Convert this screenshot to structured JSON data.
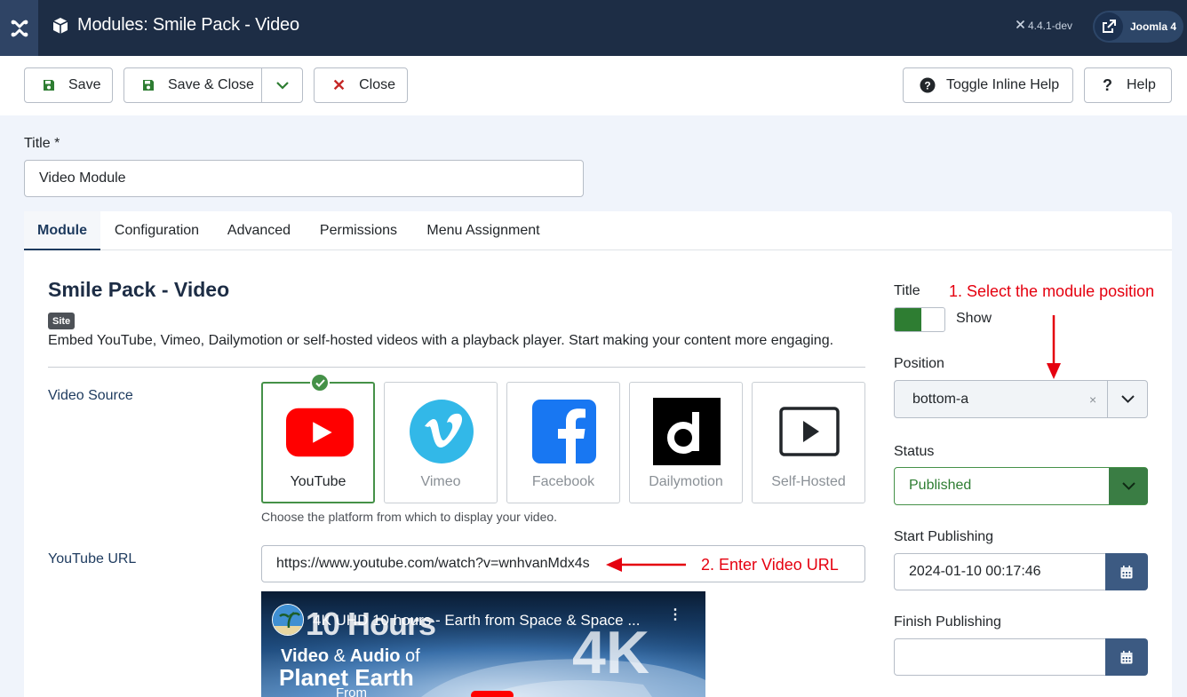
{
  "header": {
    "page_title": "Modules: Smile Pack - Video",
    "version": "4.4.1-dev",
    "site_link_label": "Joomla 4"
  },
  "toolbar": {
    "save_label": "Save",
    "save_close_label": "Save & Close",
    "close_label": "Close",
    "inline_help_label": "Toggle Inline Help",
    "help_label": "Help"
  },
  "title_field": {
    "label": "Title *",
    "value": "Video Module"
  },
  "tabs": [
    {
      "label": "Module",
      "active": true
    },
    {
      "label": "Configuration",
      "active": false
    },
    {
      "label": "Advanced",
      "active": false
    },
    {
      "label": "Permissions",
      "active": false
    },
    {
      "label": "Menu Assignment",
      "active": false
    }
  ],
  "module": {
    "title": "Smile Pack - Video",
    "badge": "Site",
    "description": "Embed YouTube, Vimeo, Dailymotion or self-hosted videos with a playback player. Start making your content more engaging.",
    "video_source": {
      "label": "Video Source",
      "options": [
        {
          "label": "YouTube",
          "icon": "youtube-icon",
          "selected": true,
          "color": "#ff0000"
        },
        {
          "label": "Vimeo",
          "icon": "vimeo-icon",
          "selected": false,
          "color": "#32b8e8"
        },
        {
          "label": "Facebook",
          "icon": "facebook-icon",
          "selected": false,
          "color": "#1877f2"
        },
        {
          "label": "Dailymotion",
          "icon": "dailymotion-icon",
          "selected": false,
          "color": "#000000"
        },
        {
          "label": "Self-Hosted",
          "icon": "play-icon",
          "selected": false,
          "color": "#000000"
        }
      ],
      "help": "Choose the platform from which to display your video."
    },
    "youtube_url": {
      "label": "YouTube URL",
      "value": "https://www.youtube.com/watch?v=wnhvanMdx4s"
    },
    "video_preview": {
      "title": "4K UHD 10 hours - Earth from Space & Space ...",
      "overlay_hours": "10 Hours",
      "overlay_4k": "4K",
      "overlay_line1_a": "Video",
      "overlay_line1_b": "&",
      "overlay_line1_c": "Audio",
      "overlay_line1_d": "of",
      "overlay_line2": "Planet Earth",
      "overlay_line3": "From"
    }
  },
  "annotations": {
    "step1": "1. Select the module position",
    "step2": "2. Enter Video URL"
  },
  "sidebar": {
    "title_label": "Title",
    "title_toggle": "Show",
    "position_label": "Position",
    "position_value": "bottom-a",
    "position_clear": "×",
    "status_label": "Status",
    "status_value": "Published",
    "start_label": "Start Publishing",
    "start_value": "2024-01-10 00:17:46",
    "finish_label": "Finish Publishing",
    "finish_value": ""
  },
  "colors": {
    "header_bg": "#1d2d45",
    "accent_green": "#459148",
    "annotation_red": "#e5000f",
    "calendar_button": "#3c5a82"
  }
}
